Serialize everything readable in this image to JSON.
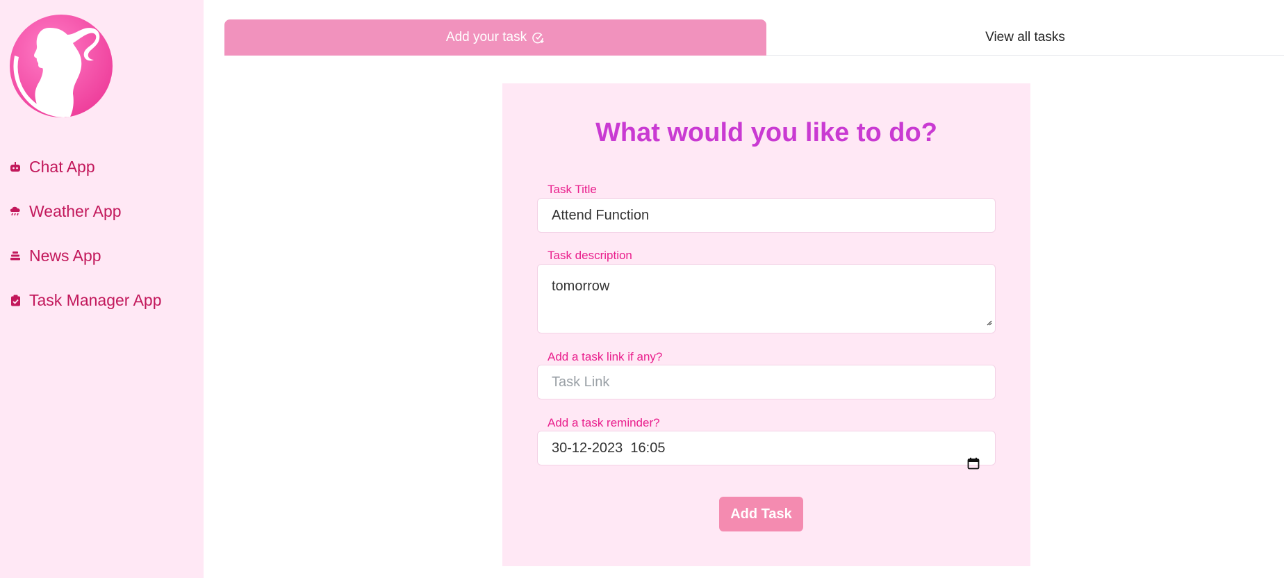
{
  "sidebar": {
    "items": [
      {
        "label": "Chat App",
        "icon": "robot-icon"
      },
      {
        "label": "Weather App",
        "icon": "cloud-rain-icon"
      },
      {
        "label": "News App",
        "icon": "layers-icon"
      },
      {
        "label": "Task Manager App",
        "icon": "clipboard-check-icon"
      }
    ]
  },
  "tabs": {
    "add_label": "Add your task",
    "view_label": "View all tasks"
  },
  "form": {
    "title": "What would you like to do?",
    "task_title_label": "Task Title",
    "task_title_value": "Attend Function",
    "description_label": "Task description",
    "description_value": "tomorrow",
    "link_label": "Add a task link if any?",
    "link_placeholder": "Task Link",
    "reminder_label": "Add a task reminder?",
    "reminder_value": "30-12-2023  16:05",
    "submit_label": "Add Task"
  },
  "colors": {
    "accent": "#f192bd",
    "sidebar_bg": "#ffe8f5",
    "nav_text": "#c2185b",
    "title": "#c93ad2",
    "label": "#e91e8c",
    "button": "#f48bb0"
  }
}
